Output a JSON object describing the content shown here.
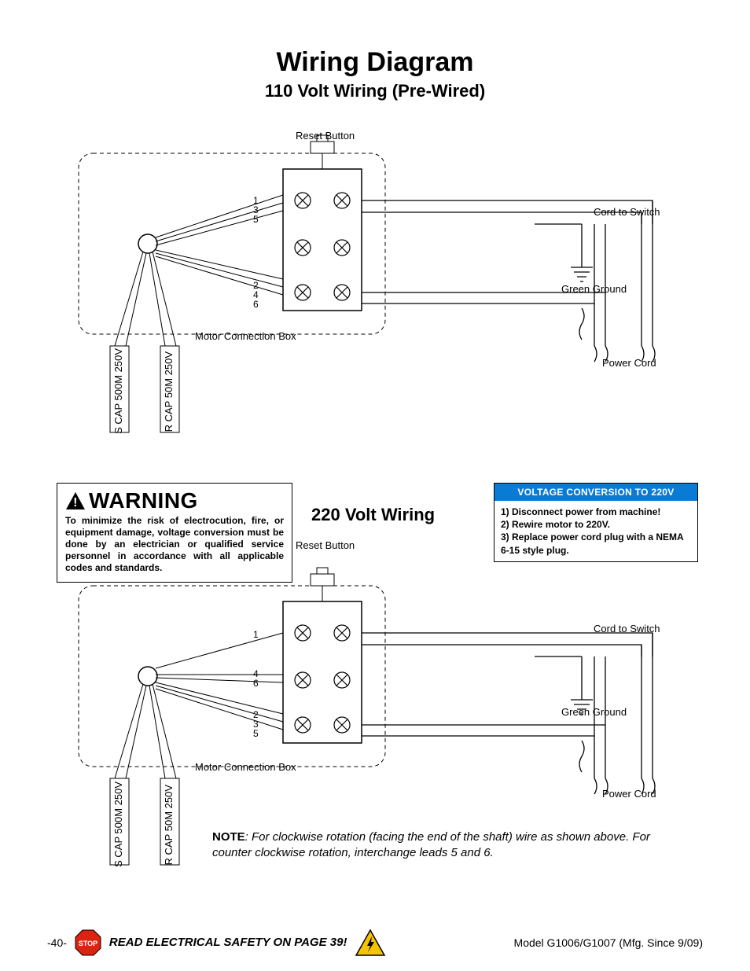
{
  "title": "Wiring Diagram",
  "subtitle": "110 Volt Wiring (Pre-Wired)",
  "reset_label_110": "Reset Button",
  "motor_box_label_110": "Motor Connection Box",
  "cord_switch_110": "Cord to Switch",
  "ground_110": "Green Ground",
  "power_cord_110": "Power Cord",
  "terminals_110_top": [
    "1",
    "3",
    "5"
  ],
  "terminals_110_bottom": [
    "2",
    "4",
    "6"
  ],
  "s_cap": "S CAP 500M 250V",
  "r_cap": "R CAP 50M 250V",
  "warning_head": "WARNING",
  "warning_body": "To minimize the risk of electrocution, fire, or equipment damage, voltage conversion must be done by an electrician or qualified service personnel in accordance with all applicable codes and standards.",
  "subheading_220": "220 Volt Wiring",
  "voltconv_head": "VOLTAGE CONVERSION TO 220V",
  "voltconv_steps": [
    "1) Disconnect power from machine!",
    "2) Rewire motor to 220V.",
    "3) Replace power cord plug with a NEMA 6-15 style plug."
  ],
  "reset_label_220": "Reset Button",
  "motor_box_label_220": "Motor Connection Box",
  "cord_switch_220": "Cord to Switch",
  "ground_220": "Green Ground",
  "power_cord_220": "Power Cord",
  "terminals_220_row1": [
    "1"
  ],
  "terminals_220_row2": [
    "4",
    "6"
  ],
  "terminals_220_row3": [
    "2",
    "3",
    "5"
  ],
  "note_prefix": "NOTE",
  "note_body": ": For clockwise rotation (facing the end of the shaft) wire as shown above. For  counter clockwise rotation, interchange leads 5 and 6.",
  "footer_page": "-40-",
  "footer_stop": "STOP",
  "footer_safety": "READ ELECTRICAL SAFETY ON PAGE 39!",
  "footer_model": "Model G1006/G1007 (Mfg. Since 9/09)"
}
